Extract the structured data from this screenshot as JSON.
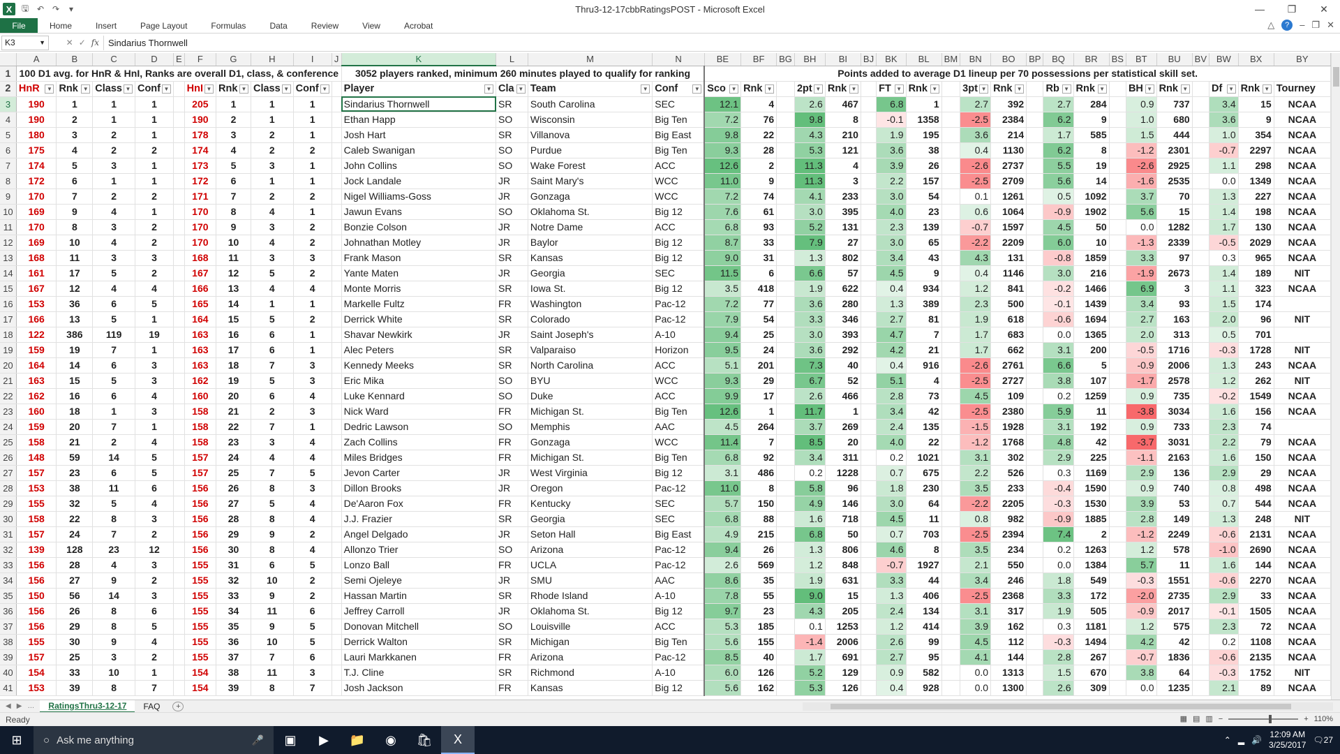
{
  "window": {
    "title": "Thru3-12-17cbbRatingsPOST - Microsoft Excel"
  },
  "ribbon": {
    "file": "File",
    "tabs": [
      "Home",
      "Insert",
      "Page Layout",
      "Formulas",
      "Data",
      "Review",
      "View",
      "Acrobat"
    ]
  },
  "formula_bar": {
    "name_box": "K3",
    "fx": "fx",
    "content": "Sindarius Thornwell"
  },
  "columns": [
    {
      "id": "A",
      "label": "A",
      "w": 58
    },
    {
      "id": "B",
      "label": "B",
      "w": 52
    },
    {
      "id": "C",
      "label": "C",
      "w": 56
    },
    {
      "id": "D",
      "label": "D",
      "w": 46
    },
    {
      "id": "E",
      "label": "E",
      "w": 14
    },
    {
      "id": "F",
      "label": "F",
      "w": 44
    },
    {
      "id": "G",
      "label": "G",
      "w": 50
    },
    {
      "id": "H",
      "label": "H",
      "w": 56
    },
    {
      "id": "I",
      "label": "I",
      "w": 48
    },
    {
      "id": "J",
      "label": "J",
      "w": 14
    },
    {
      "id": "K",
      "label": "K",
      "w": 230
    },
    {
      "id": "L",
      "label": "L",
      "w": 46
    },
    {
      "id": "M",
      "label": "M",
      "w": 186
    },
    {
      "id": "N",
      "label": "N",
      "w": 76
    },
    {
      "id": "BE",
      "label": "BE",
      "w": 54
    },
    {
      "id": "BF",
      "label": "BF",
      "w": 52
    },
    {
      "id": "BG",
      "label": "BG",
      "w": 14
    },
    {
      "id": "BH",
      "label": "BH",
      "w": 44
    },
    {
      "id": "BI",
      "label": "BI",
      "w": 52
    },
    {
      "id": "BJ",
      "label": "BJ",
      "w": 14
    },
    {
      "id": "BK",
      "label": "BK",
      "w": 44
    },
    {
      "id": "BL",
      "label": "BL",
      "w": 52
    },
    {
      "id": "BM",
      "label": "BM",
      "w": 14
    },
    {
      "id": "BN",
      "label": "BN",
      "w": 44
    },
    {
      "id": "BO",
      "label": "BO",
      "w": 52
    },
    {
      "id": "BP",
      "label": "BP",
      "w": 14
    },
    {
      "id": "BQ",
      "label": "BQ",
      "w": 44
    },
    {
      "id": "BR",
      "label": "BR",
      "w": 52
    },
    {
      "id": "BS",
      "label": "BS",
      "w": 14
    },
    {
      "id": "BT",
      "label": "BT",
      "w": 44
    },
    {
      "id": "BU",
      "label": "BU",
      "w": 52
    },
    {
      "id": "BV",
      "label": "BV",
      "w": 14
    },
    {
      "id": "BW",
      "label": "BW",
      "w": 44
    },
    {
      "id": "BX",
      "label": "BX",
      "w": 52
    },
    {
      "id": "BY",
      "label": "BY",
      "w": 91
    }
  ],
  "row1": {
    "left": "100 D1 avg. for HnR & HnI, Ranks are overall D1, class, & conference",
    "mid": "3052 players ranked, minimum 260 minutes played to qualify for ranking",
    "right": "Points added to average D1 lineup per 70 possessions per statistical skill set."
  },
  "headers": [
    "HnR",
    "Rnk",
    "Class",
    "Conf",
    "",
    "HnI",
    "Rnk",
    "Class",
    "Conf",
    "",
    "Player",
    "Cla",
    "Team",
    "Conf",
    "Sco",
    "Rnk",
    "",
    "2pt",
    "Rnk",
    "",
    "FT",
    "Rnk",
    "",
    "3pt",
    "Rnk",
    "",
    "Rb",
    "Rnk",
    "",
    "BH",
    "Rnk",
    "",
    "Df",
    "Rnk",
    "Tourney"
  ],
  "rows": [
    [
      "190",
      "1",
      "1",
      "1",
      "205",
      "1",
      "1",
      "1",
      "Sindarius Thornwell",
      "SR",
      "South Carolina",
      "SEC",
      "12.1",
      "4",
      "2.6",
      "467",
      "6.8",
      "1",
      "2.7",
      "392",
      "2.7",
      "284",
      "0.9",
      "737",
      "3.4",
      "15",
      "NCAA"
    ],
    [
      "190",
      "2",
      "1",
      "1",
      "190",
      "2",
      "1",
      "1",
      "Ethan Happ",
      "SO",
      "Wisconsin",
      "Big Ten",
      "7.2",
      "76",
      "9.8",
      "8",
      "-0.1",
      "1358",
      "-2.5",
      "2384",
      "6.2",
      "9",
      "1.0",
      "680",
      "3.6",
      "9",
      "NCAA"
    ],
    [
      "180",
      "3",
      "2",
      "1",
      "178",
      "3",
      "2",
      "1",
      "Josh Hart",
      "SR",
      "Villanova",
      "Big East",
      "9.8",
      "22",
      "4.3",
      "210",
      "1.9",
      "195",
      "3.6",
      "214",
      "1.7",
      "585",
      "1.5",
      "444",
      "1.0",
      "354",
      "NCAA"
    ],
    [
      "175",
      "4",
      "2",
      "2",
      "174",
      "4",
      "2",
      "2",
      "Caleb Swanigan",
      "SO",
      "Purdue",
      "Big Ten",
      "9.3",
      "28",
      "5.3",
      "121",
      "3.6",
      "38",
      "0.4",
      "1130",
      "6.2",
      "8",
      "-1.2",
      "2301",
      "-0.7",
      "2297",
      "NCAA"
    ],
    [
      "174",
      "5",
      "3",
      "1",
      "173",
      "5",
      "3",
      "1",
      "John Collins",
      "SO",
      "Wake Forest",
      "ACC",
      "12.6",
      "2",
      "11.3",
      "4",
      "3.9",
      "26",
      "-2.6",
      "2737",
      "5.5",
      "19",
      "-2.6",
      "2925",
      "1.1",
      "298",
      "NCAA"
    ],
    [
      "172",
      "6",
      "1",
      "1",
      "172",
      "6",
      "1",
      "1",
      "Jock Landale",
      "JR",
      "Saint Mary's",
      "WCC",
      "11.0",
      "9",
      "11.3",
      "3",
      "2.2",
      "157",
      "-2.5",
      "2709",
      "5.6",
      "14",
      "-1.6",
      "2535",
      "0.0",
      "1349",
      "NCAA"
    ],
    [
      "170",
      "7",
      "2",
      "2",
      "171",
      "7",
      "2",
      "2",
      "Nigel Williams-Goss",
      "JR",
      "Gonzaga",
      "WCC",
      "7.2",
      "74",
      "4.1",
      "233",
      "3.0",
      "54",
      "0.1",
      "1261",
      "0.5",
      "1092",
      "3.7",
      "70",
      "1.3",
      "227",
      "NCAA"
    ],
    [
      "169",
      "9",
      "4",
      "1",
      "170",
      "8",
      "4",
      "1",
      "Jawun Evans",
      "SO",
      "Oklahoma St.",
      "Big 12",
      "7.6",
      "61",
      "3.0",
      "395",
      "4.0",
      "23",
      "0.6",
      "1064",
      "-0.9",
      "1902",
      "5.6",
      "15",
      "1.4",
      "198",
      "NCAA"
    ],
    [
      "170",
      "8",
      "3",
      "2",
      "170",
      "9",
      "3",
      "2",
      "Bonzie Colson",
      "JR",
      "Notre Dame",
      "ACC",
      "6.8",
      "93",
      "5.2",
      "131",
      "2.3",
      "139",
      "-0.7",
      "1597",
      "4.5",
      "50",
      "0.0",
      "1282",
      "1.7",
      "130",
      "NCAA"
    ],
    [
      "169",
      "10",
      "4",
      "2",
      "170",
      "10",
      "4",
      "2",
      "Johnathan Motley",
      "JR",
      "Baylor",
      "Big 12",
      "8.7",
      "33",
      "7.9",
      "27",
      "3.0",
      "65",
      "-2.2",
      "2209",
      "6.0",
      "10",
      "-1.3",
      "2339",
      "-0.5",
      "2029",
      "NCAA"
    ],
    [
      "168",
      "11",
      "3",
      "3",
      "168",
      "11",
      "3",
      "3",
      "Frank Mason",
      "SR",
      "Kansas",
      "Big 12",
      "9.0",
      "31",
      "1.3",
      "802",
      "3.4",
      "43",
      "4.3",
      "131",
      "-0.8",
      "1859",
      "3.3",
      "97",
      "0.3",
      "965",
      "NCAA"
    ],
    [
      "161",
      "17",
      "5",
      "2",
      "167",
      "12",
      "5",
      "2",
      "Yante Maten",
      "JR",
      "Georgia",
      "SEC",
      "11.5",
      "6",
      "6.6",
      "57",
      "4.5",
      "9",
      "0.4",
      "1146",
      "3.0",
      "216",
      "-1.9",
      "2673",
      "1.4",
      "189",
      "NIT"
    ],
    [
      "167",
      "12",
      "4",
      "4",
      "166",
      "13",
      "4",
      "4",
      "Monte Morris",
      "SR",
      "Iowa St.",
      "Big 12",
      "3.5",
      "418",
      "1.9",
      "622",
      "0.4",
      "934",
      "1.2",
      "841",
      "-0.2",
      "1466",
      "6.9",
      "3",
      "1.1",
      "323",
      "NCAA"
    ],
    [
      "153",
      "36",
      "6",
      "5",
      "165",
      "14",
      "1",
      "1",
      "Markelle Fultz",
      "FR",
      "Washington",
      "Pac-12",
      "7.2",
      "77",
      "3.6",
      "280",
      "1.3",
      "389",
      "2.3",
      "500",
      "-0.1",
      "1439",
      "3.4",
      "93",
      "1.5",
      "174",
      ""
    ],
    [
      "166",
      "13",
      "5",
      "1",
      "164",
      "15",
      "5",
      "2",
      "Derrick White",
      "SR",
      "Colorado",
      "Pac-12",
      "7.9",
      "54",
      "3.3",
      "346",
      "2.7",
      "81",
      "1.9",
      "618",
      "-0.6",
      "1694",
      "2.7",
      "163",
      "2.0",
      "96",
      "NIT"
    ],
    [
      "122",
      "386",
      "119",
      "19",
      "163",
      "16",
      "6",
      "1",
      "Shavar Newkirk",
      "JR",
      "Saint Joseph's",
      "A-10",
      "9.4",
      "25",
      "3.0",
      "393",
      "4.7",
      "7",
      "1.7",
      "683",
      "0.0",
      "1365",
      "2.0",
      "313",
      "0.5",
      "701",
      ""
    ],
    [
      "159",
      "19",
      "7",
      "1",
      "163",
      "17",
      "6",
      "1",
      "Alec Peters",
      "SR",
      "Valparaiso",
      "Horizon",
      "9.5",
      "24",
      "3.6",
      "292",
      "4.2",
      "21",
      "1.7",
      "662",
      "3.1",
      "200",
      "-0.5",
      "1716",
      "-0.3",
      "1728",
      "NIT"
    ],
    [
      "164",
      "14",
      "6",
      "3",
      "163",
      "18",
      "7",
      "3",
      "Kennedy Meeks",
      "SR",
      "North Carolina",
      "ACC",
      "5.1",
      "201",
      "7.3",
      "40",
      "0.4",
      "916",
      "-2.6",
      "2761",
      "6.6",
      "5",
      "-0.9",
      "2006",
      "1.3",
      "243",
      "NCAA"
    ],
    [
      "163",
      "15",
      "5",
      "3",
      "162",
      "19",
      "5",
      "3",
      "Eric Mika",
      "SO",
      "BYU",
      "WCC",
      "9.3",
      "29",
      "6.7",
      "52",
      "5.1",
      "4",
      "-2.5",
      "2727",
      "3.8",
      "107",
      "-1.7",
      "2578",
      "1.2",
      "262",
      "NIT"
    ],
    [
      "162",
      "16",
      "6",
      "4",
      "160",
      "20",
      "6",
      "4",
      "Luke Kennard",
      "SO",
      "Duke",
      "ACC",
      "9.9",
      "17",
      "2.6",
      "466",
      "2.8",
      "73",
      "4.5",
      "109",
      "0.2",
      "1259",
      "0.9",
      "735",
      "-0.2",
      "1549",
      "NCAA"
    ],
    [
      "160",
      "18",
      "1",
      "3",
      "158",
      "21",
      "2",
      "3",
      "Nick Ward",
      "FR",
      "Michigan St.",
      "Big Ten",
      "12.6",
      "1",
      "11.7",
      "1",
      "3.4",
      "42",
      "-2.5",
      "2380",
      "5.9",
      "11",
      "-3.8",
      "3034",
      "1.6",
      "156",
      "NCAA"
    ],
    [
      "159",
      "20",
      "7",
      "1",
      "158",
      "22",
      "7",
      "1",
      "Dedric Lawson",
      "SO",
      "Memphis",
      "AAC",
      "4.5",
      "264",
      "3.7",
      "269",
      "2.4",
      "135",
      "-1.5",
      "1928",
      "3.1",
      "192",
      "0.9",
      "733",
      "2.3",
      "74",
      ""
    ],
    [
      "158",
      "21",
      "2",
      "4",
      "158",
      "23",
      "3",
      "4",
      "Zach Collins",
      "FR",
      "Gonzaga",
      "WCC",
      "11.4",
      "7",
      "8.5",
      "20",
      "4.0",
      "22",
      "-1.2",
      "1768",
      "4.8",
      "42",
      "-3.7",
      "3031",
      "2.2",
      "79",
      "NCAA"
    ],
    [
      "148",
      "59",
      "14",
      "5",
      "157",
      "24",
      "4",
      "4",
      "Miles Bridges",
      "FR",
      "Michigan St.",
      "Big Ten",
      "6.8",
      "92",
      "3.4",
      "311",
      "0.2",
      "1021",
      "3.1",
      "302",
      "2.9",
      "225",
      "-1.1",
      "2163",
      "1.6",
      "150",
      "NCAA"
    ],
    [
      "157",
      "23",
      "6",
      "5",
      "157",
      "25",
      "7",
      "5",
      "Jevon Carter",
      "JR",
      "West Virginia",
      "Big 12",
      "3.1",
      "486",
      "0.2",
      "1228",
      "0.7",
      "675",
      "2.2",
      "526",
      "0.3",
      "1169",
      "2.9",
      "136",
      "2.9",
      "29",
      "NCAA"
    ],
    [
      "153",
      "38",
      "11",
      "6",
      "156",
      "26",
      "8",
      "3",
      "Dillon Brooks",
      "JR",
      "Oregon",
      "Pac-12",
      "11.0",
      "8",
      "5.8",
      "96",
      "1.8",
      "230",
      "3.5",
      "233",
      "-0.4",
      "1590",
      "0.9",
      "740",
      "0.8",
      "498",
      "NCAA"
    ],
    [
      "155",
      "32",
      "5",
      "4",
      "156",
      "27",
      "5",
      "4",
      "De'Aaron Fox",
      "FR",
      "Kentucky",
      "SEC",
      "5.7",
      "150",
      "4.9",
      "146",
      "3.0",
      "64",
      "-2.2",
      "2205",
      "-0.3",
      "1530",
      "3.9",
      "53",
      "0.7",
      "544",
      "NCAA"
    ],
    [
      "158",
      "22",
      "8",
      "3",
      "156",
      "28",
      "8",
      "4",
      "J.J. Frazier",
      "SR",
      "Georgia",
      "SEC",
      "6.8",
      "88",
      "1.6",
      "718",
      "4.5",
      "11",
      "0.8",
      "982",
      "-0.9",
      "1885",
      "2.8",
      "149",
      "1.3",
      "248",
      "NIT"
    ],
    [
      "157",
      "24",
      "7",
      "2",
      "156",
      "29",
      "9",
      "2",
      "Angel Delgado",
      "JR",
      "Seton Hall",
      "Big East",
      "4.9",
      "215",
      "6.8",
      "50",
      "0.7",
      "703",
      "-2.5",
      "2394",
      "7.4",
      "2",
      "-1.2",
      "2249",
      "-0.6",
      "2131",
      "NCAA"
    ],
    [
      "139",
      "128",
      "23",
      "12",
      "156",
      "30",
      "8",
      "4",
      "Allonzo Trier",
      "SO",
      "Arizona",
      "Pac-12",
      "9.4",
      "26",
      "1.3",
      "806",
      "4.6",
      "8",
      "3.5",
      "234",
      "0.2",
      "1263",
      "1.2",
      "578",
      "-1.0",
      "2690",
      "NCAA"
    ],
    [
      "156",
      "28",
      "4",
      "3",
      "155",
      "31",
      "6",
      "5",
      "Lonzo Ball",
      "FR",
      "UCLA",
      "Pac-12",
      "2.6",
      "569",
      "1.2",
      "848",
      "-0.7",
      "1927",
      "2.1",
      "550",
      "0.0",
      "1384",
      "5.7",
      "11",
      "1.6",
      "144",
      "NCAA"
    ],
    [
      "156",
      "27",
      "9",
      "2",
      "155",
      "32",
      "10",
      "2",
      "Semi Ojeleye",
      "JR",
      "SMU",
      "AAC",
      "8.6",
      "35",
      "1.9",
      "631",
      "3.3",
      "44",
      "3.4",
      "246",
      "1.8",
      "549",
      "-0.3",
      "1551",
      "-0.6",
      "2270",
      "NCAA"
    ],
    [
      "150",
      "56",
      "14",
      "3",
      "155",
      "33",
      "9",
      "2",
      "Hassan Martin",
      "SR",
      "Rhode Island",
      "A-10",
      "7.8",
      "55",
      "9.0",
      "15",
      "1.3",
      "406",
      "-2.5",
      "2368",
      "3.3",
      "172",
      "-2.0",
      "2735",
      "2.9",
      "33",
      "NCAA"
    ],
    [
      "156",
      "26",
      "8",
      "6",
      "155",
      "34",
      "11",
      "6",
      "Jeffrey Carroll",
      "JR",
      "Oklahoma St.",
      "Big 12",
      "9.7",
      "23",
      "4.3",
      "205",
      "2.4",
      "134",
      "3.1",
      "317",
      "1.9",
      "505",
      "-0.9",
      "2017",
      "-0.1",
      "1505",
      "NCAA"
    ],
    [
      "156",
      "29",
      "8",
      "5",
      "155",
      "35",
      "9",
      "5",
      "Donovan Mitchell",
      "SO",
      "Louisville",
      "ACC",
      "5.3",
      "185",
      "0.1",
      "1253",
      "1.2",
      "414",
      "3.9",
      "162",
      "0.3",
      "1181",
      "1.2",
      "575",
      "2.3",
      "72",
      "NCAA"
    ],
    [
      "155",
      "30",
      "9",
      "4",
      "155",
      "36",
      "10",
      "5",
      "Derrick Walton",
      "SR",
      "Michigan",
      "Big Ten",
      "5.6",
      "155",
      "-1.4",
      "2006",
      "2.6",
      "99",
      "4.5",
      "112",
      "-0.3",
      "1494",
      "4.2",
      "42",
      "0.2",
      "1108",
      "NCAA"
    ],
    [
      "157",
      "25",
      "3",
      "2",
      "155",
      "37",
      "7",
      "6",
      "Lauri Markkanen",
      "FR",
      "Arizona",
      "Pac-12",
      "8.5",
      "40",
      "1.7",
      "691",
      "2.7",
      "95",
      "4.1",
      "144",
      "2.8",
      "267",
      "-0.7",
      "1836",
      "-0.6",
      "2135",
      "NCAA"
    ],
    [
      "154",
      "33",
      "10",
      "1",
      "154",
      "38",
      "11",
      "3",
      "T.J. Cline",
      "SR",
      "Richmond",
      "A-10",
      "6.0",
      "126",
      "5.2",
      "129",
      "0.9",
      "582",
      "0.0",
      "1313",
      "1.5",
      "670",
      "3.8",
      "64",
      "-0.3",
      "1752",
      "NIT"
    ],
    [
      "153",
      "39",
      "8",
      "7",
      "154",
      "39",
      "8",
      "7",
      "Josh Jackson",
      "FR",
      "Kansas",
      "Big 12",
      "5.6",
      "162",
      "5.3",
      "126",
      "0.4",
      "928",
      "0.0",
      "1300",
      "2.6",
      "309",
      "0.0",
      "1235",
      "2.1",
      "89",
      "NCAA"
    ]
  ],
  "sheet_tabs": [
    "RatingsThru3-12-17",
    "FAQ"
  ],
  "status": {
    "ready": "Ready",
    "zoom": "110%"
  },
  "taskbar": {
    "search_placeholder": "Ask me anything",
    "time": "12:09 AM",
    "date": "3/25/2017",
    "notifications": "27"
  },
  "colors": {
    "excel_green": "#217346",
    "rank_red": "#d00000",
    "heat_green": "#63be7b",
    "heat_red": "#f8696b"
  }
}
